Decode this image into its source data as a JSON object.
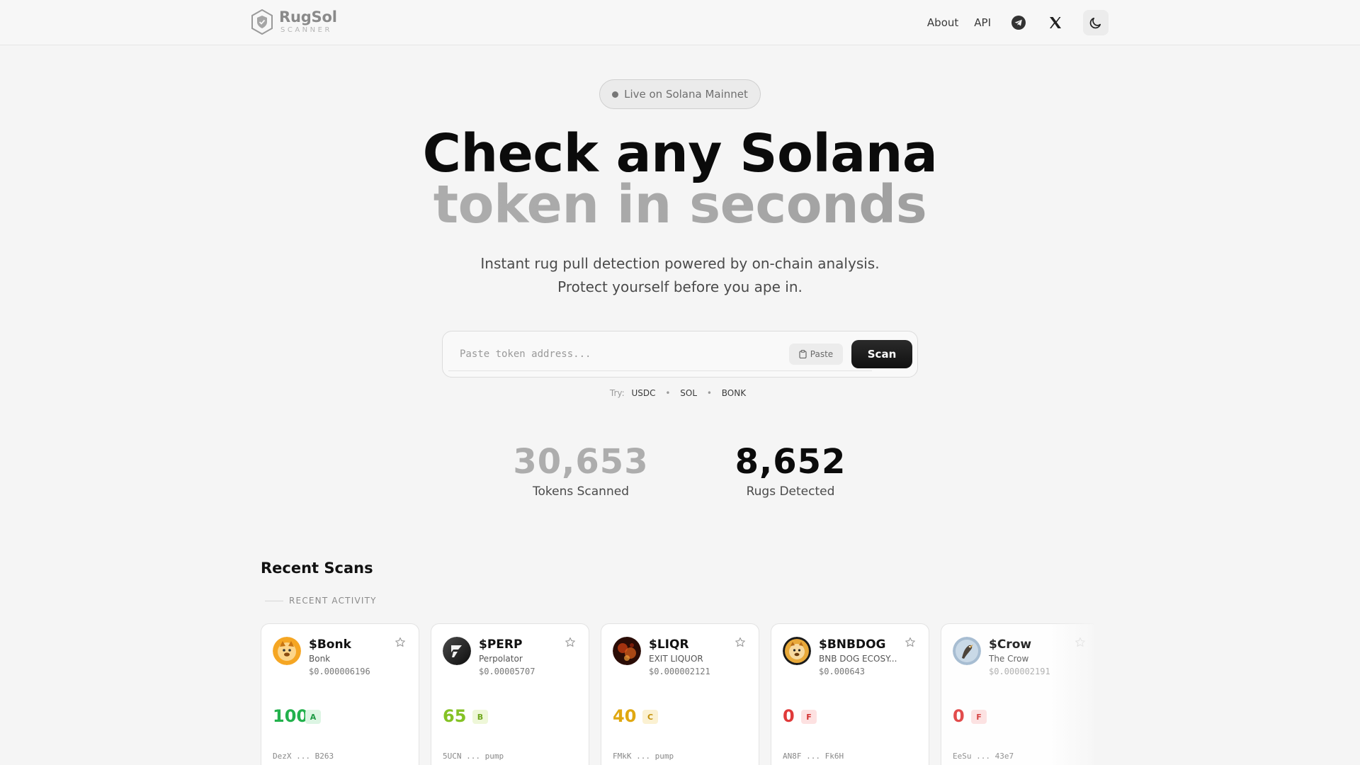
{
  "header": {
    "logo_name": "RugSol",
    "logo_sub": "SCANNER",
    "nav": {
      "about": "About",
      "api": "API"
    },
    "icons": [
      "telegram-icon",
      "x-icon",
      "moon-icon"
    ]
  },
  "hero": {
    "badge": "Live on Solana Mainnet",
    "title_line1": "Check any Solana",
    "title_line2": "token in seconds",
    "subtitle_line1": "Instant rug pull detection powered by on-chain analysis.",
    "subtitle_line2": "Protect yourself before you ape in."
  },
  "search": {
    "placeholder": "Paste token address...",
    "value": "",
    "paste_label": "Paste",
    "scan_label": "Scan",
    "try_label": "Try:",
    "try_tokens": [
      "USDC",
      "SOL",
      "BONK"
    ]
  },
  "stats": {
    "tokens_scanned": "30,653",
    "tokens_scanned_label": "Tokens Scanned",
    "rugs_detected": "8,652",
    "rugs_detected_label": "Rugs Detected"
  },
  "recent": {
    "title": "Recent Scans",
    "label": "RECENT ACTIVITY",
    "cards": [
      {
        "symbol": "$Bonk",
        "name": "Bonk",
        "price": "$0.000006196",
        "score": "100",
        "grade": "A",
        "address": "DezX ... B263"
      },
      {
        "symbol": "$PERP",
        "name": "Perpolator",
        "price": "$0.00005707",
        "score": "65",
        "grade": "B",
        "address": "5UCN ... pump"
      },
      {
        "symbol": "$LIQR",
        "name": "EXIT LIQUOR",
        "price": "$0.000002121",
        "score": "40",
        "grade": "C",
        "address": "FMkK ... pump"
      },
      {
        "symbol": "$BNBDOG",
        "name": "BNB DOG ECOSY...",
        "price": "$0.000643",
        "score": "0",
        "grade": "F",
        "address": "AN8F ... Fk6H"
      },
      {
        "symbol": "$Crow",
        "name": "The Crow",
        "price": "$0.000002191",
        "score": "0",
        "grade": "F",
        "address": "EeSu ... 43e7"
      }
    ]
  },
  "colors": {
    "grade_a": "#22b14c",
    "grade_b": "#84c225",
    "grade_c": "#e0a811",
    "grade_f": "#e03a3a",
    "primary_button": "#111111"
  }
}
